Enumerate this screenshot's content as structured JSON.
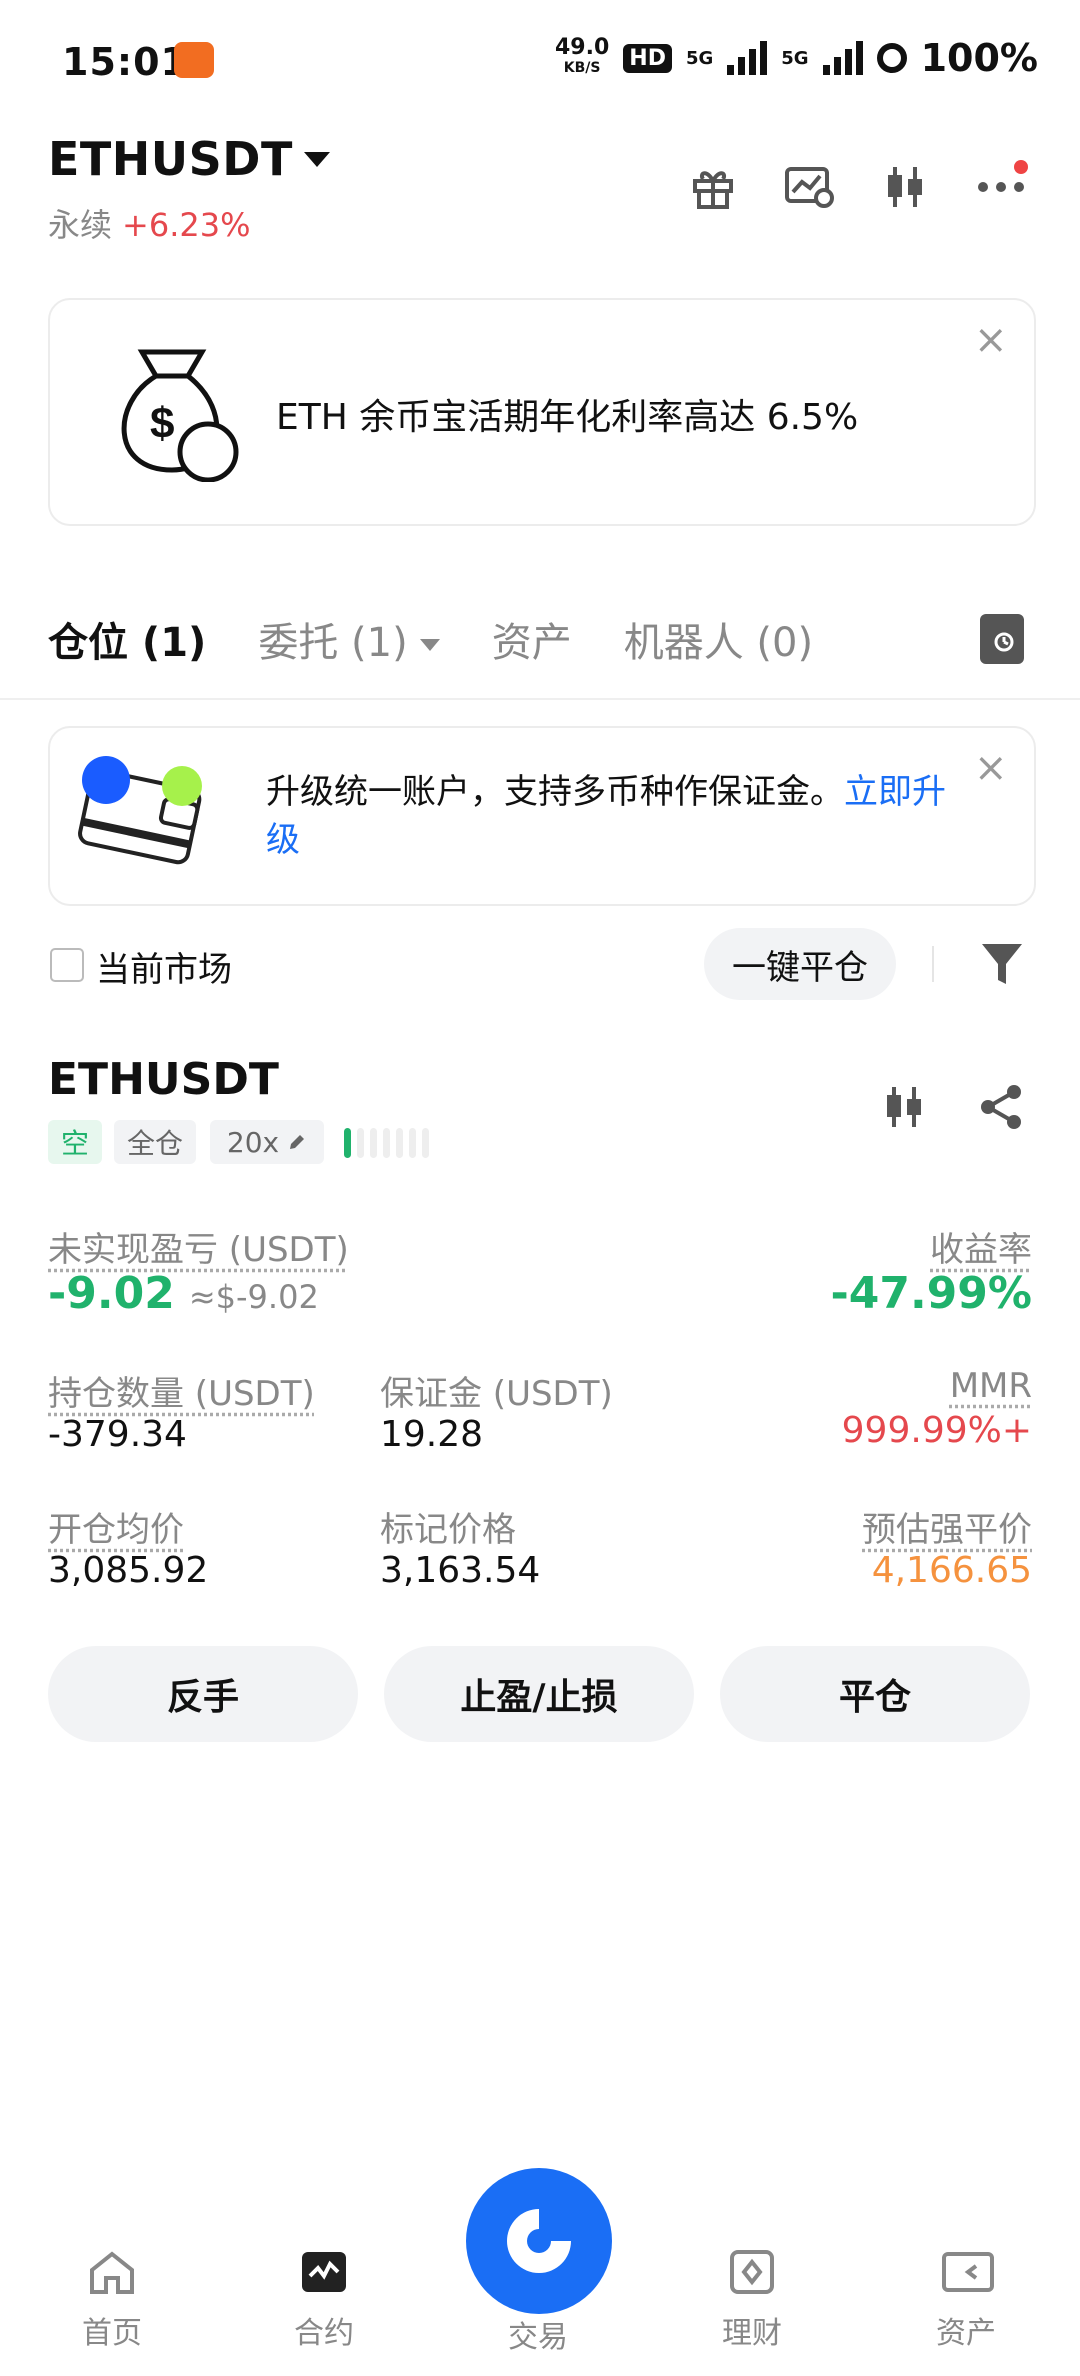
{
  "status_bar": {
    "time": "15:01",
    "speed_value": "49.0",
    "speed_unit": "KB/S",
    "hd": "HD",
    "net1": "5G",
    "net2": "5G",
    "battery": "100%"
  },
  "header": {
    "pair": "ETHUSDT",
    "type": "永续",
    "change": "+6.23%",
    "icons": [
      "gift-icon",
      "chart-settings-icon",
      "candlestick-icon",
      "more-icon"
    ]
  },
  "promo": {
    "text": "ETH 余币宝活期年化利率高达 6.5%",
    "close": "×"
  },
  "tabs": [
    {
      "label": "仓位 (1)"
    },
    {
      "label": "委托 (1)"
    },
    {
      "label": "资产"
    },
    {
      "label": "机器人 (0)"
    }
  ],
  "upgrade": {
    "text": "升级统一账户，支持多币种作保证金。",
    "link": "立即升级",
    "close": "×"
  },
  "filter": {
    "current_market": "当前市场",
    "close_all": "一键平仓"
  },
  "position": {
    "symbol": "ETHUSDT",
    "side": "空",
    "margin_mode": "全仓",
    "leverage": "20x",
    "risk_level": 1,
    "unrealized_pnl_label": "未实现盈亏 (USDT)",
    "unrealized_pnl": "-9.02",
    "unrealized_pnl_usd": "≈$-9.02",
    "roe_label": "收益率",
    "roe": "-47.99%",
    "size_label": "持仓数量 (USDT)",
    "size": "-379.34",
    "margin_label": "保证金 (USDT)",
    "margin": "19.28",
    "mmr_label": "MMR",
    "mmr": "999.99%+",
    "entry_label": "开仓均价",
    "entry": "3,085.92",
    "mark_label": "标记价格",
    "mark": "3,163.54",
    "liq_label": "预估强平价",
    "liq": "4,166.65"
  },
  "actions": {
    "reverse": "反手",
    "tp_sl": "止盈/止损",
    "close": "平仓"
  },
  "nav": {
    "home": "首页",
    "futures": "合约",
    "trade": "交易",
    "earn": "理财",
    "assets": "资产"
  },
  "colors": {
    "accent": "#1a6ef5",
    "up": "#e5484d",
    "down": "#20b26c",
    "warn": "#f5923e"
  }
}
